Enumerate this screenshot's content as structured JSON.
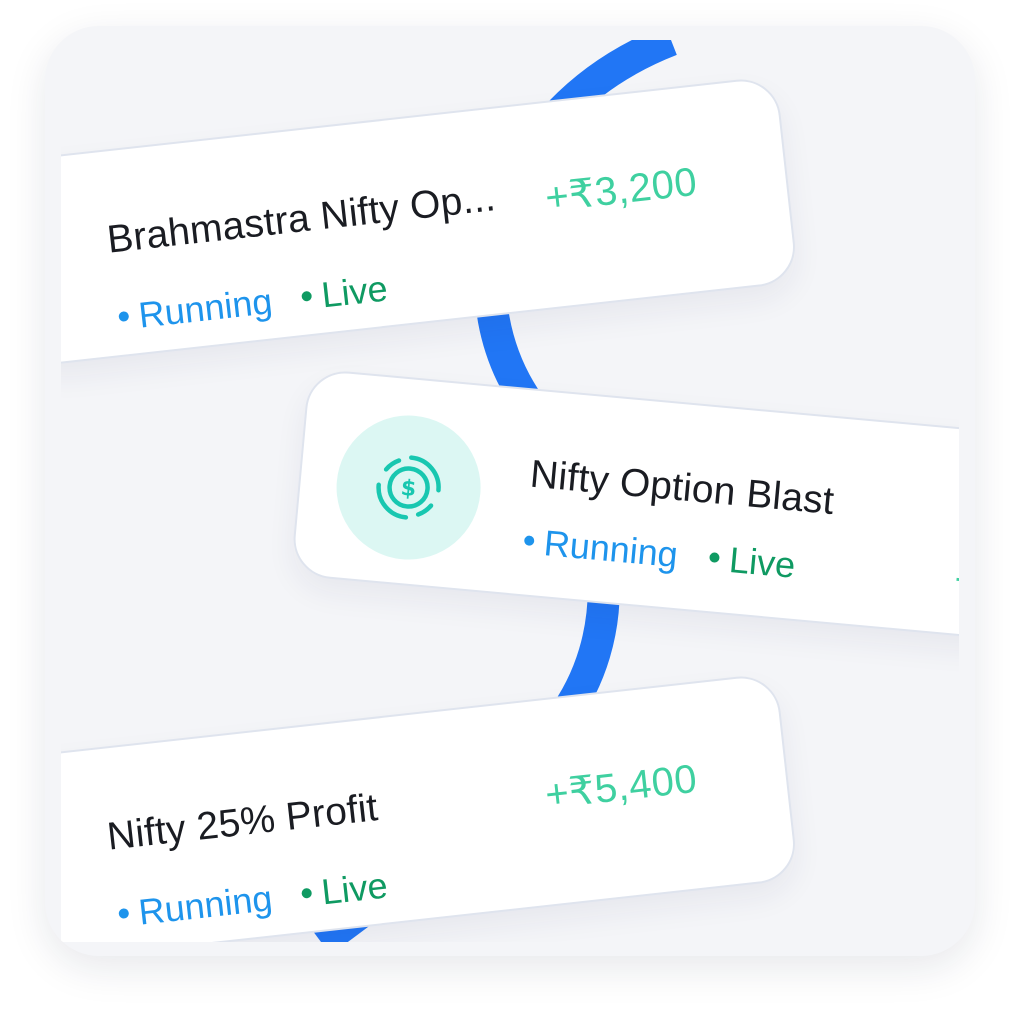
{
  "colors": {
    "panel_background": "#f4f5f8",
    "track_blue": "#2176f5",
    "running": "#1e94ec",
    "live": "#0f9a62",
    "profit": "#3fd0a0",
    "icon_bg": "#dcf7f3",
    "icon_fg": "#18c7b0"
  },
  "strategies": [
    {
      "name": "Brahmastra Nifty Op...",
      "status": "Running",
      "mode": "Live",
      "pnl": "+₹3,200"
    },
    {
      "name": "Nifty Option Blast",
      "status": "Running",
      "mode": "Live",
      "pnl": "+",
      "icon": "dollar-coin-refresh-icon"
    },
    {
      "name": "Nifty 25% Profit",
      "status": "Running",
      "mode": "Live",
      "pnl": "+₹5,400"
    }
  ]
}
